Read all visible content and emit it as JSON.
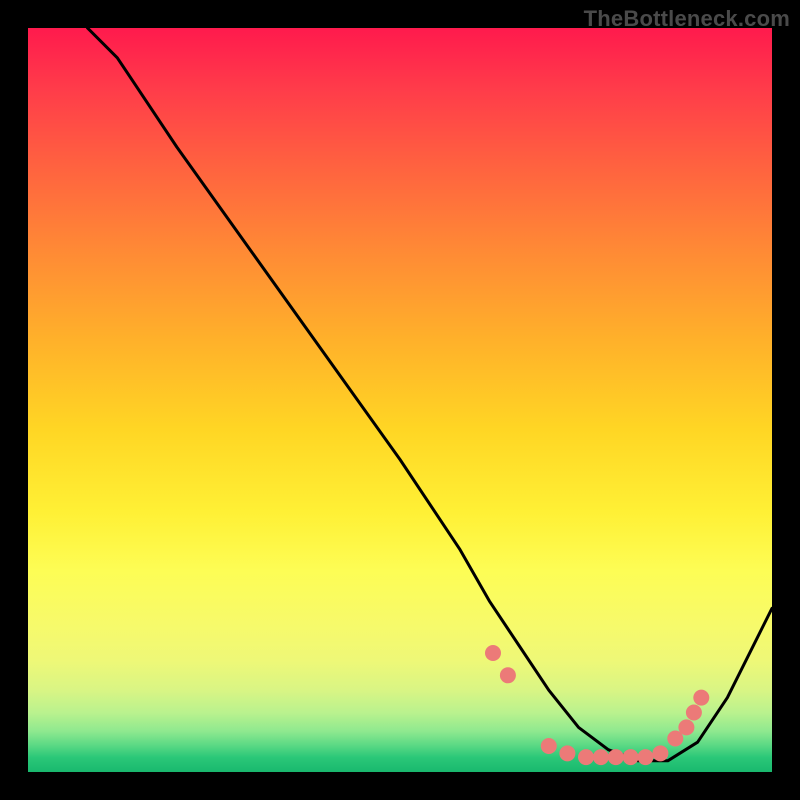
{
  "watermark": "TheBottleneck.com",
  "colors": {
    "background": "#000000",
    "curve": "#000000",
    "marker": "#ec7a78"
  },
  "chart_data": {
    "type": "line",
    "title": "",
    "xlabel": "",
    "ylabel": "",
    "xlim": [
      0,
      100
    ],
    "ylim": [
      0,
      100
    ],
    "grid": false,
    "series": [
      {
        "name": "curve",
        "x": [
          8,
          12,
          20,
          30,
          40,
          50,
          58,
          62,
          66,
          70,
          74,
          78,
          82,
          86,
          90,
          94,
          100
        ],
        "y": [
          100,
          96,
          84,
          70,
          56,
          42,
          30,
          23,
          17,
          11,
          6,
          3,
          1.5,
          1.5,
          4,
          10,
          22
        ]
      }
    ],
    "markers": {
      "name": "data-points",
      "x": [
        62.5,
        64.5,
        70,
        72.5,
        75,
        77,
        79,
        81,
        83,
        85,
        87,
        88.5,
        89.5,
        90.5
      ],
      "y": [
        16,
        13,
        3.5,
        2.5,
        2,
        2,
        2,
        2,
        2,
        2.5,
        4.5,
        6,
        8,
        10
      ]
    },
    "gradient_stops": [
      {
        "pct": 0,
        "color": "#ff1a4d"
      },
      {
        "pct": 18,
        "color": "#ff6040"
      },
      {
        "pct": 42,
        "color": "#ffb12a"
      },
      {
        "pct": 65,
        "color": "#fff035"
      },
      {
        "pct": 85,
        "color": "#eef877"
      },
      {
        "pct": 96,
        "color": "#58d884"
      },
      {
        "pct": 100,
        "color": "#19b86e"
      }
    ]
  }
}
